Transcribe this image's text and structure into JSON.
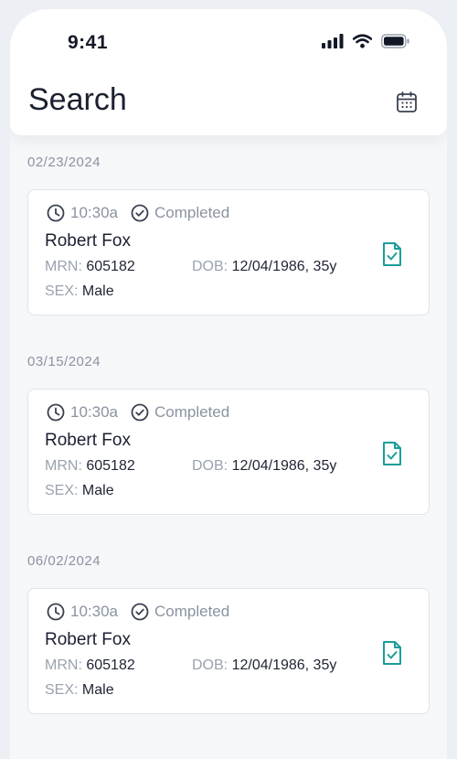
{
  "status": {
    "time": "9:41"
  },
  "header": {
    "title": "Search"
  },
  "colors": {
    "accent": "#1a9e9a",
    "muted": "#8a93a1"
  },
  "groups": [
    {
      "date": "02/23/2024",
      "card": {
        "time": "10:30a",
        "status": "Completed",
        "name": "Robert Fox",
        "mrn_label": "MRN:",
        "mrn": "605182",
        "dob_label": "DOB:",
        "dob": "12/04/1986, 35y",
        "sex_label": "SEX:",
        "sex": "Male"
      }
    },
    {
      "date": "03/15/2024",
      "card": {
        "time": "10:30a",
        "status": "Completed",
        "name": "Robert Fox",
        "mrn_label": "MRN:",
        "mrn": "605182",
        "dob_label": "DOB:",
        "dob": "12/04/1986, 35y",
        "sex_label": "SEX:",
        "sex": "Male"
      }
    },
    {
      "date": "06/02/2024",
      "card": {
        "time": "10:30a",
        "status": "Completed",
        "name": "Robert Fox",
        "mrn_label": "MRN:",
        "mrn": "605182",
        "dob_label": "DOB:",
        "dob": "12/04/1986, 35y",
        "sex_label": "SEX:",
        "sex": "Male"
      }
    }
  ]
}
